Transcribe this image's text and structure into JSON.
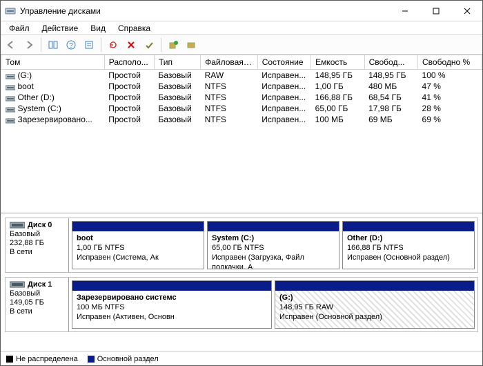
{
  "window": {
    "title": "Управление дисками"
  },
  "menu": {
    "file": "Файл",
    "action": "Действие",
    "view": "Вид",
    "help": "Справка"
  },
  "columns": {
    "tom": "Том",
    "layout": "Располо...",
    "type": "Тип",
    "fs": "Файловая с...",
    "state": "Состояние",
    "capacity": "Емкость",
    "free": "Свобод...",
    "freepct": "Свободно %"
  },
  "volumes": [
    {
      "name": "(G:)",
      "layout": "Простой",
      "type": "Базовый",
      "fs": "RAW",
      "state": "Исправен...",
      "capacity": "148,95 ГБ",
      "free": "148,95 ГБ",
      "freepct": "100 %"
    },
    {
      "name": "boot",
      "layout": "Простой",
      "type": "Базовый",
      "fs": "NTFS",
      "state": "Исправен...",
      "capacity": "1,00 ГБ",
      "free": "480 МБ",
      "freepct": "47 %"
    },
    {
      "name": "Other (D:)",
      "layout": "Простой",
      "type": "Базовый",
      "fs": "NTFS",
      "state": "Исправен...",
      "capacity": "166,88 ГБ",
      "free": "68,54 ГБ",
      "freepct": "41 %"
    },
    {
      "name": "System (C:)",
      "layout": "Простой",
      "type": "Базовый",
      "fs": "NTFS",
      "state": "Исправен...",
      "capacity": "65,00 ГБ",
      "free": "17,98 ГБ",
      "freepct": "28 %"
    },
    {
      "name": "Зарезервировано...",
      "layout": "Простой",
      "type": "Базовый",
      "fs": "NTFS",
      "state": "Исправен...",
      "capacity": "100 МБ",
      "free": "69 МБ",
      "freepct": "69 %"
    }
  ],
  "disks": [
    {
      "name": "Диск 0",
      "type": "Базовый",
      "size": "232,88 ГБ",
      "status": "В сети",
      "parts": [
        {
          "pname": "boot",
          "psize": "1,00 ГБ NTFS",
          "pstate": "Исправен (Система, Ак",
          "hatched": false
        },
        {
          "pname": "System  (C:)",
          "psize": "65,00 ГБ NTFS",
          "pstate": "Исправен (Загрузка, Файл подкачки, А",
          "hatched": false
        },
        {
          "pname": "Other  (D:)",
          "psize": "166,88 ГБ NTFS",
          "pstate": "Исправен (Основной раздел)",
          "hatched": false
        }
      ]
    },
    {
      "name": "Диск 1",
      "type": "Базовый",
      "size": "149,05 ГБ",
      "status": "В сети",
      "parts": [
        {
          "pname": "Зарезервировано системс",
          "psize": "100 МБ NTFS",
          "pstate": "Исправен (Активен, Основн",
          "hatched": false
        },
        {
          "pname": "(G:)",
          "psize": "148,95 ГБ RAW",
          "pstate": "Исправен (Основной раздел)",
          "hatched": true
        }
      ]
    }
  ],
  "legend": {
    "unalloc": "Не распределена",
    "primary": "Основной раздел"
  }
}
